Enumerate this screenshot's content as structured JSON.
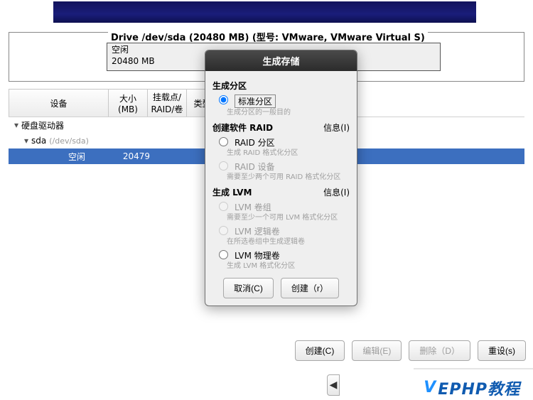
{
  "drive": {
    "title": "Drive /dev/sda (20480 MB) (型号: VMware, VMware Virtual S)",
    "free_label": "空闲",
    "free_size": "20480 MB"
  },
  "headers": {
    "device": "设备",
    "size": "大小\n(MB)",
    "mount": "挂载点/\nRAID/卷",
    "type": "类型"
  },
  "tree": {
    "root": "硬盘驱动器",
    "disk": "sda",
    "disk_path": "(/dev/sda)",
    "free_row_label": "空闲",
    "free_row_size": "20479"
  },
  "bottom": {
    "create": "创建(C)",
    "edit": "编辑(E)",
    "delete": "删除（D）",
    "reset": "重设(s)"
  },
  "watermark": {
    "v": "V",
    "rest": "EPHP教程"
  },
  "dialog": {
    "title": "生成存储",
    "sec_partition": "生成分区",
    "opt_standard": "标准分区",
    "hint_standard": "生成分区的一般目的",
    "sec_raid": "创建软件 RAID",
    "info": "信息(I)",
    "opt_raid_part": "RAID 分区",
    "hint_raid_part": "生成 RAID 格式化分区",
    "opt_raid_dev": "RAID 设备",
    "hint_raid_dev": "需要至少两个可用 RAID 格式化分区",
    "sec_lvm": "生成 LVM",
    "opt_lvm_vg": "LVM 卷组",
    "hint_lvm_vg": "需要至少一个可用 LVM 格式化分区",
    "opt_lvm_lv": "LVM 逻辑卷",
    "hint_lvm_lv": "在所选卷组中生成逻辑卷",
    "opt_lvm_pv": "LVM 物理卷",
    "hint_lvm_pv": "生成 LVM 格式化分区",
    "cancel": "取消(C)",
    "create": "创建（r）"
  }
}
